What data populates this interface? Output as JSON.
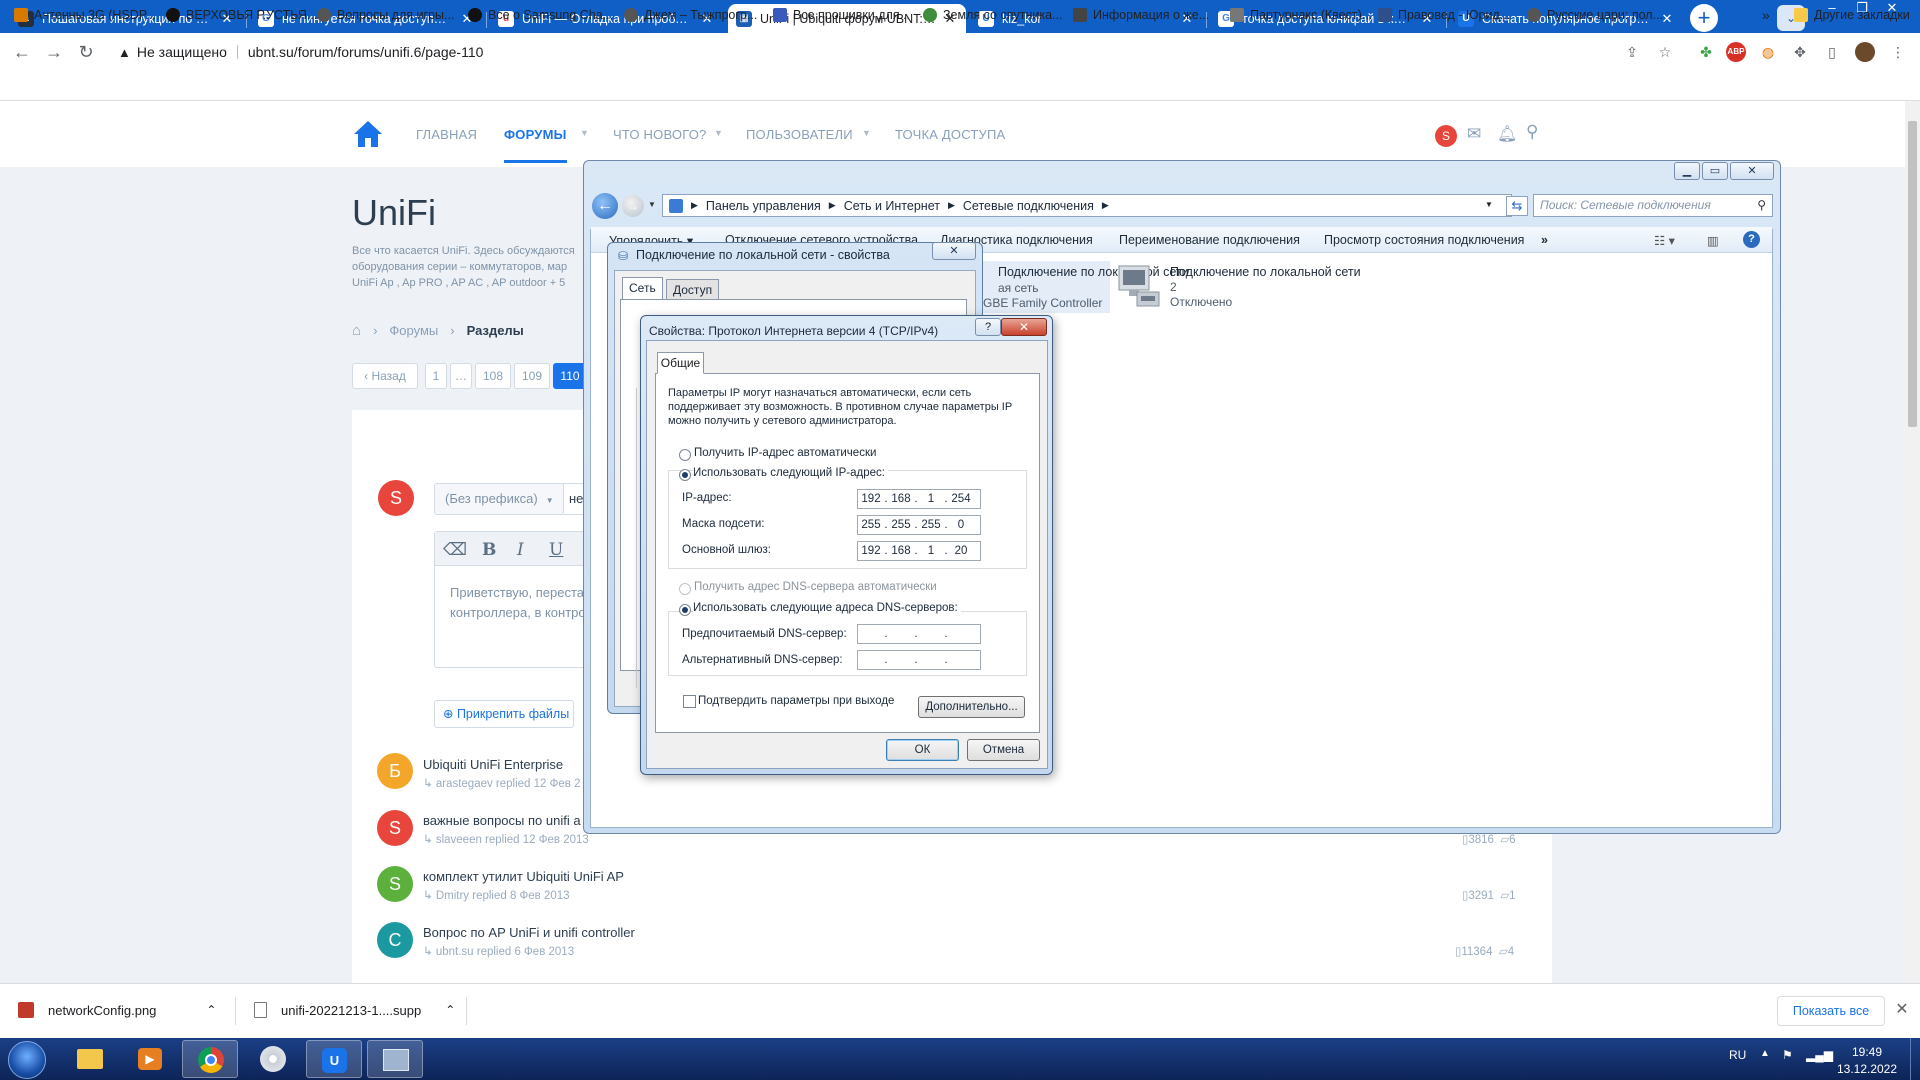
{
  "browser": {
    "tabs": [
      {
        "title": "Пошаговая инструкция по восс",
        "favicon": "amazon-icon",
        "active": false
      },
      {
        "title": "не пингуется точка доступа юн",
        "favicon": "google-icon",
        "active": false
      },
      {
        "title": "UniFi — Отладка при проблема",
        "favicon": "unifi-help-icon",
        "active": false
      },
      {
        "title": "UniFi | Ubiquiti форум UBNT: ин",
        "favicon": "ubnt-icon",
        "active": true
      },
      {
        "title": "kiz_kor",
        "favicon": "u-icon",
        "active": false
      },
      {
        "title": "точка доступа юнифай в клиент",
        "favicon": "google-icon",
        "active": false
      },
      {
        "title": "Скачать популярное программ",
        "favicon": "u-icon",
        "active": false
      }
    ],
    "security_label": "Не защищено",
    "url": "ubnt.su/forum/forums/unifi.6/page-110",
    "bookmarks": [
      "Антенны 3G (HSDP...",
      "ВЕРХОВЬЯ Р.УСТЬЯ...",
      "Вопросы для игры...",
      "Все о Samsung Cha...",
      "Джем – Тыжпрогр...",
      "Все прошивки для...",
      "Земля со спутника...",
      "Информация о же...",
      "Партурнакс (Квест)...",
      "Правовед - Юрид...",
      "Русские цари: пол..."
    ],
    "bookmarks_overflow": "»",
    "other_bookmarks": "Другие закладки"
  },
  "site": {
    "nav": [
      "ГЛАВНАЯ",
      "ФОРУМЫ",
      "ЧТО НОВОГО?",
      "ПОЛЬЗОВАТЕЛИ",
      "ТОЧКА ДОСТУПА"
    ],
    "user_initial": "S",
    "title": "UniFi",
    "description": "Все что касается UniFi. Здесь обсуждаются оборудования серии – коммутаторов, мар UniFi Ap , Ap PRO , AP AC , AP outdoor + 5",
    "breadcrumb": [
      "Форумы",
      "Разделы"
    ],
    "pagination": {
      "prev": "‹ Назад",
      "pages": [
        "1",
        "…",
        "108",
        "109",
        "110"
      ],
      "current": "110"
    },
    "composer": {
      "avatar": "S",
      "prefix": "(Без префикса)",
      "title_value": "не",
      "body_text": "Приветствую, переста контроллера, в контро",
      "attach_label": "⊕ Прикрепить файлы"
    },
    "threads": [
      {
        "initial": "Б",
        "color": "#f4a62a",
        "title": "Ubiquiti UniFi Enterprise",
        "meta": "↳ arastegaev replied 12 Фев 2",
        "views": "",
        "replies": ""
      },
      {
        "initial": "S",
        "color": "#e8453c",
        "title": "важные вопросы по unifi a",
        "meta": "↳ slaveeen replied 12 Фев 2013",
        "views": "3816",
        "replies": "6"
      },
      {
        "initial": "S",
        "color": "#5cb03c",
        "title": "комплект утилит Ubiquiti UniFi AP",
        "meta": "↳ Dmitry replied 8 Фев 2013",
        "views": "3291",
        "replies": "1"
      },
      {
        "initial": "C",
        "color": "#1a9aa0",
        "title": "Вопрос по AP UniFi и unifi controller",
        "meta": "↳ ubnt.su replied 6 Фев 2013",
        "views": "11364",
        "replies": "4"
      }
    ]
  },
  "explorer": {
    "breadcrumb": [
      "Панель управления",
      "Сеть и Интернет",
      "Сетевые подключения"
    ],
    "search_placeholder": "Поиск: Сетевые подключения",
    "commands": [
      "Упорядочить ▾",
      "Отключение сетевого устройства",
      "Диагностика подключения",
      "Переименование подключения",
      "Просмотр состояния подключения",
      "»"
    ],
    "item1": {
      "name": "Подключение по локальной сети",
      "line2": "ая сеть",
      "device": "GBE Family Controller"
    },
    "item2": {
      "name": "Подключение по локальной сети",
      "number": "2",
      "status": "Отключено"
    }
  },
  "dialog_lan": {
    "title": "Подключение по локальной сети - свойства",
    "tabs": [
      "Сеть",
      "Доступ"
    ]
  },
  "dialog_ipv4": {
    "title": "Свойства: Протокол Интернета версии 4 (TCP/IPv4)",
    "tab": "Общие",
    "intro": "Параметры IP могут назначаться автоматически, если сеть поддерживает эту возможность. В противном случае параметры IP можно получить у сетевого администратора.",
    "ip_auto_label": "Получить IP-адрес автоматически",
    "ip_manual_label": "Использовать следующий IP-адрес:",
    "ip_label": "IP-адрес:",
    "ip": [
      "192",
      "168",
      "1",
      "254"
    ],
    "mask_label": "Маска подсети:",
    "mask": [
      "255",
      "255",
      "255",
      "0"
    ],
    "gateway_label": "Основной шлюз:",
    "gateway": [
      "192",
      "168",
      "1",
      "20"
    ],
    "dns_auto_label": "Получить адрес DNS-сервера автоматически",
    "dns_manual_label": "Использовать следующие адреса DNS-серверов:",
    "dns1_label": "Предпочитаемый DNS-сервер:",
    "dns2_label": "Альтернативный DNS-сервер:",
    "validate_label": "Подтвердить параметры при выходе",
    "advanced_label": "Дополнительно...",
    "ok_label": "ОК",
    "cancel_label": "Отмена",
    "help_label": "?"
  },
  "downloads": {
    "items": [
      "networkConfig.png",
      "unifi-20221213-1....supp"
    ],
    "show_all": "Показать все"
  },
  "taskbar": {
    "language": "RU",
    "time": "19:49",
    "date": "13.12.2022"
  }
}
